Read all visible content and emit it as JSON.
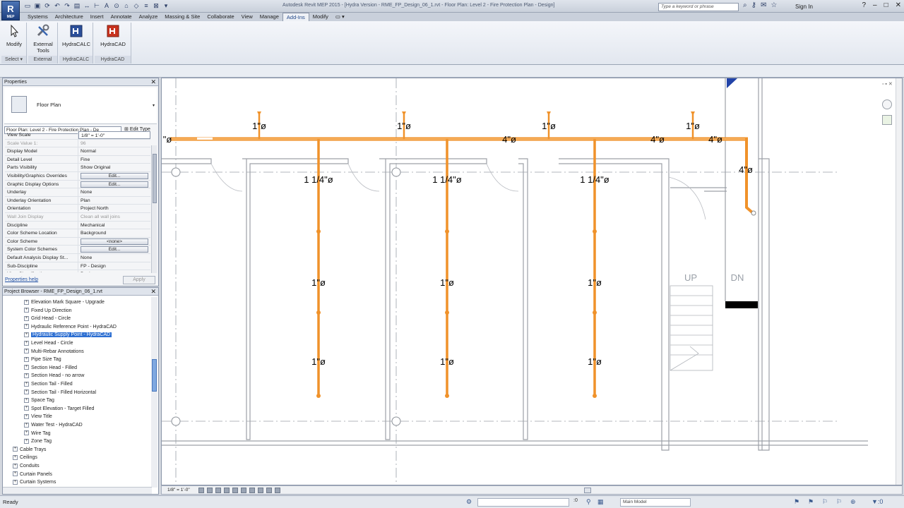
{
  "app": {
    "logo_letter": "R",
    "logo_sub": "MEP",
    "window_title": "Autodesk Revit MEP 2015 - [Hydra Version - RME_FP_Design_06_1.rvt - Floor Plan: Level 2 - Fire Protection Plan - Design]",
    "search_placeholder": "Type a keyword or phrase",
    "sign_in": "Sign In"
  },
  "tabs": [
    "Systems",
    "Architecture",
    "Insert",
    "Annotate",
    "Analyze",
    "Massing & Site",
    "Collaborate",
    "View",
    "Manage",
    "Add-Ins",
    "Modify"
  ],
  "active_tab_index": 9,
  "ribbon": {
    "tools": [
      "Modify",
      "External Tools",
      "HydraCALC",
      "HydraCAD"
    ],
    "panels": [
      "Select",
      "External",
      "HydraCALC",
      "HydraCAD"
    ]
  },
  "properties": {
    "header": "Properties",
    "type_name": "Floor Plan",
    "selector": "Floor Plan: Level 2 - Fire Protection Plan - De",
    "edit_type": "Edit Type",
    "rows": [
      {
        "k": "View Scale",
        "v": "1/8\" = 1'-0\"",
        "kind": "input"
      },
      {
        "k": "Scale Value  1:",
        "v": "96",
        "kind": "disabled"
      },
      {
        "k": "Display Model",
        "v": "Normal",
        "kind": "text"
      },
      {
        "k": "Detail Level",
        "v": "Fine",
        "kind": "text"
      },
      {
        "k": "Parts Visibility",
        "v": "Show Original",
        "kind": "text"
      },
      {
        "k": "Visibility/Graphics Overrides",
        "v": "Edit...",
        "kind": "button"
      },
      {
        "k": "Graphic Display Options",
        "v": "Edit...",
        "kind": "button"
      },
      {
        "k": "Underlay",
        "v": "None",
        "kind": "text"
      },
      {
        "k": "Underlay Orientation",
        "v": "Plan",
        "kind": "text"
      },
      {
        "k": "Orientation",
        "v": "Project North",
        "kind": "text"
      },
      {
        "k": "Wall Join Display",
        "v": "Clean all wall joins",
        "kind": "disabled"
      },
      {
        "k": "Discipline",
        "v": "Mechanical",
        "kind": "text"
      },
      {
        "k": "Color Scheme Location",
        "v": "Background",
        "kind": "text"
      },
      {
        "k": "Color Scheme",
        "v": "<none>",
        "kind": "button"
      },
      {
        "k": "System Color Schemes",
        "v": "Edit...",
        "kind": "button"
      },
      {
        "k": "Default Analysis Display St...",
        "v": "None",
        "kind": "text"
      },
      {
        "k": "Sub-Discipline",
        "v": "FP - Design",
        "kind": "text"
      },
      {
        "k": "View Classification",
        "v": "Design",
        "kind": "text"
      }
    ],
    "help_link": "Properties help",
    "apply": "Apply"
  },
  "browser": {
    "header": "Project Browser - RME_FP_Design_06_1.rvt",
    "items": [
      {
        "t": "Elevation Mark Square - Upgrade",
        "lvl": 2
      },
      {
        "t": "Fixed Up Direction",
        "lvl": 2
      },
      {
        "t": "Grid Head - Circle",
        "lvl": 2
      },
      {
        "t": "Hydraulic Reference Point - HydraCAD",
        "lvl": 2
      },
      {
        "t": "Hydraulic Supply Point - HydraCAD",
        "lvl": 2,
        "sel": true
      },
      {
        "t": "Level Head - Circle",
        "lvl": 2
      },
      {
        "t": "Multi-Rebar Annotations",
        "lvl": 2
      },
      {
        "t": "Pipe Size Tag",
        "lvl": 2
      },
      {
        "t": "Section Head - Filled",
        "lvl": 2
      },
      {
        "t": "Section Head - no arrow",
        "lvl": 2
      },
      {
        "t": "Section Tail - Filled",
        "lvl": 2
      },
      {
        "t": "Section Tail - Filled Horizontal",
        "lvl": 2
      },
      {
        "t": "Space Tag",
        "lvl": 2
      },
      {
        "t": "Spot Elevation - Target Filled",
        "lvl": 2
      },
      {
        "t": "View Title",
        "lvl": 2
      },
      {
        "t": "Water Test - HydraCAD",
        "lvl": 2
      },
      {
        "t": "Wire Tag",
        "lvl": 2
      },
      {
        "t": "Zone Tag",
        "lvl": 2
      },
      {
        "t": "Cable Trays",
        "lvl": 1
      },
      {
        "t": "Ceilings",
        "lvl": 1
      },
      {
        "t": "Conduits",
        "lvl": 1
      },
      {
        "t": "Curtain Panels",
        "lvl": 1
      },
      {
        "t": "Curtain Systems",
        "lvl": 1
      }
    ]
  },
  "drawing": {
    "pipe_color": "#f0922a",
    "head_tags": [
      "1\"ø",
      "1\"ø",
      "1\"ø",
      "1\"ø"
    ],
    "main_tags": [
      "\"ø",
      "4\"ø",
      "4\"ø",
      "4\"ø",
      "4\"ø"
    ],
    "branch_tags": [
      "1 1/4\"ø",
      "1 1/4\"ø",
      "1 1/4\"ø"
    ],
    "branch_sub_tags": [
      "1\"ø",
      "1\"ø",
      "1\"ø",
      "1\"ø",
      "1\"ø",
      "1\"ø"
    ],
    "stair_up": "UP",
    "stair_dn": "DN"
  },
  "view_control": {
    "scale": "1/8\" = 1'-0\""
  },
  "status": {
    "ready": "Ready",
    "value0": ":0",
    "model": "Main Model"
  }
}
